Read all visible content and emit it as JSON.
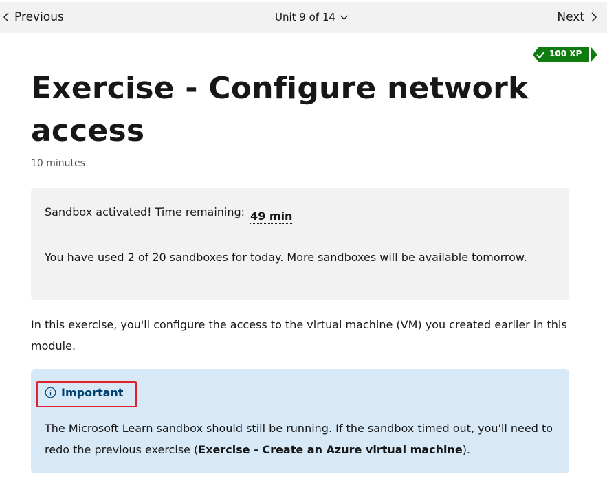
{
  "nav": {
    "previous_label": "Previous",
    "unit_label": "Unit 9 of 14",
    "next_label": "Next"
  },
  "xp_badge": {
    "label": "100 XP",
    "color": "#107c10"
  },
  "page": {
    "title": "Exercise - Configure network access",
    "duration": "10 minutes"
  },
  "sandbox": {
    "status_label": "Sandbox activated! Time remaining:",
    "time_remaining": "49 min",
    "usage_text": "You have used 2 of 20 sandboxes for today. More sandboxes will be available tomorrow."
  },
  "intro_text": "In this exercise, you'll configure the access to the virtual machine (VM) you created earlier in this module.",
  "important": {
    "title": "Important",
    "body_before": "The Microsoft Learn sandbox should still be running. If the sandbox timed out, you'll need to redo the previous exercise (",
    "body_bold": "Exercise - Create an Azure virtual machine",
    "body_after": ")."
  },
  "colors": {
    "nav_bg": "#f2f2f2",
    "sandbox_bg": "#f2f2f2",
    "important_bg": "#d7e9f7",
    "important_title": "#004173",
    "highlight_border": "#e0212b"
  }
}
